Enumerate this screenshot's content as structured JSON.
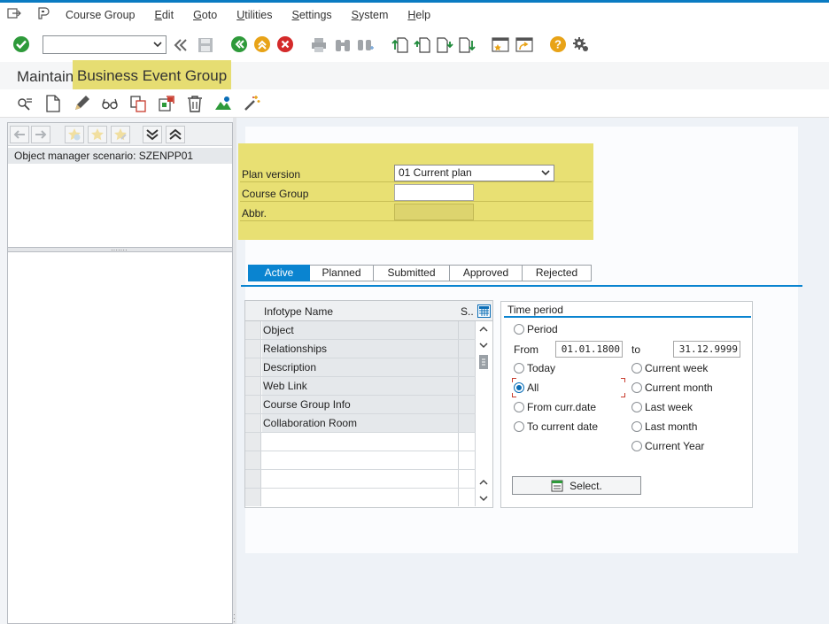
{
  "menu": {
    "items": [
      {
        "label": "Course Group",
        "u": ""
      },
      {
        "label": "dit",
        "u": "E"
      },
      {
        "label": "oto",
        "u": "G"
      },
      {
        "label": "tilities",
        "u": "U"
      },
      {
        "label": "ettings",
        "u": "S"
      },
      {
        "label": "ystem",
        "u": "S"
      },
      {
        "label": "elp",
        "u": "H"
      }
    ]
  },
  "toolbar": {
    "command_field_value": ""
  },
  "title": {
    "prefix": "Maintain",
    "highlighted": "Business Event Group"
  },
  "left_pane": {
    "scenario": "Object manager scenario: SZENPP01"
  },
  "form": {
    "plan_version_label": "Plan version",
    "plan_version_value": "01 Current plan",
    "course_group_label": "Course Group",
    "course_group_value": "",
    "abbr_label": "Abbr.",
    "abbr_value": ""
  },
  "tabs": [
    {
      "label": "Active",
      "active": true
    },
    {
      "label": "Planned",
      "active": false
    },
    {
      "label": "Submitted",
      "active": false
    },
    {
      "label": "Approved",
      "active": false
    },
    {
      "label": "Rejected",
      "active": false
    }
  ],
  "infotype_grid": {
    "col_name": "Infotype Name",
    "col_status": "S..",
    "rows": [
      "Object",
      "Relationships",
      "Description",
      "Web Link",
      "Course Group Info",
      "Collaboration Room"
    ]
  },
  "time_period": {
    "title": "Time period",
    "period": "Period",
    "from_label": "From",
    "from_value": "01.01.1800",
    "to_label": "to",
    "to_value": "31.12.9999",
    "today": "Today",
    "all": "All",
    "from_curr_date": "From curr.date",
    "to_current_date": "To current date",
    "current_week": "Current week",
    "current_month": "Current month",
    "last_week": "Last week",
    "last_month": "Last month",
    "current_year": "Current Year",
    "selected": "All",
    "select_button": "Select."
  }
}
